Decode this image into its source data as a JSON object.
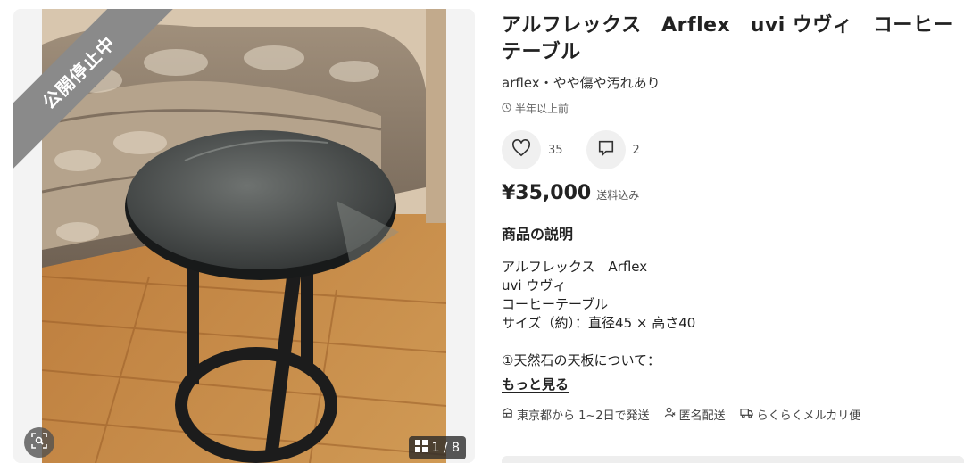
{
  "listing": {
    "status_ribbon": "公開停止中",
    "photo_counter": "1 / 8",
    "title": "アルフレックス　Arflex　uvi ウヴィ　コーヒーテーブル",
    "subtitle": "arflex・やや傷や汚れあり",
    "posted": "半年以上前",
    "likes": "35",
    "comments": "2",
    "price": "¥35,000",
    "shipping_note": "送料込み",
    "description_heading": "商品の説明",
    "description_lines": [
      "アルフレックス　Arflex",
      "uvi  ウヴィ",
      "コーヒーテーブル",
      "サイズ（約）：直径45 × 高さ40",
      "①天然石の天板について："
    ],
    "more_label": "もっと見る",
    "shipping_from": "東京都から 1~2日で発送",
    "anonymous": "匿名配送",
    "delivery_method": "らくらくメルカリ便"
  },
  "icons": {
    "like": "heart-icon",
    "comment": "comment-icon",
    "time": "clock-icon",
    "lens": "image-search-icon",
    "gallery": "grid-icon",
    "ship": "box-icon",
    "anon": "person-icon",
    "truck": "truck-icon"
  },
  "colors": {
    "ribbon": "#8a8a8a",
    "button_bg": "#f0f0f0",
    "text": "#222222"
  }
}
